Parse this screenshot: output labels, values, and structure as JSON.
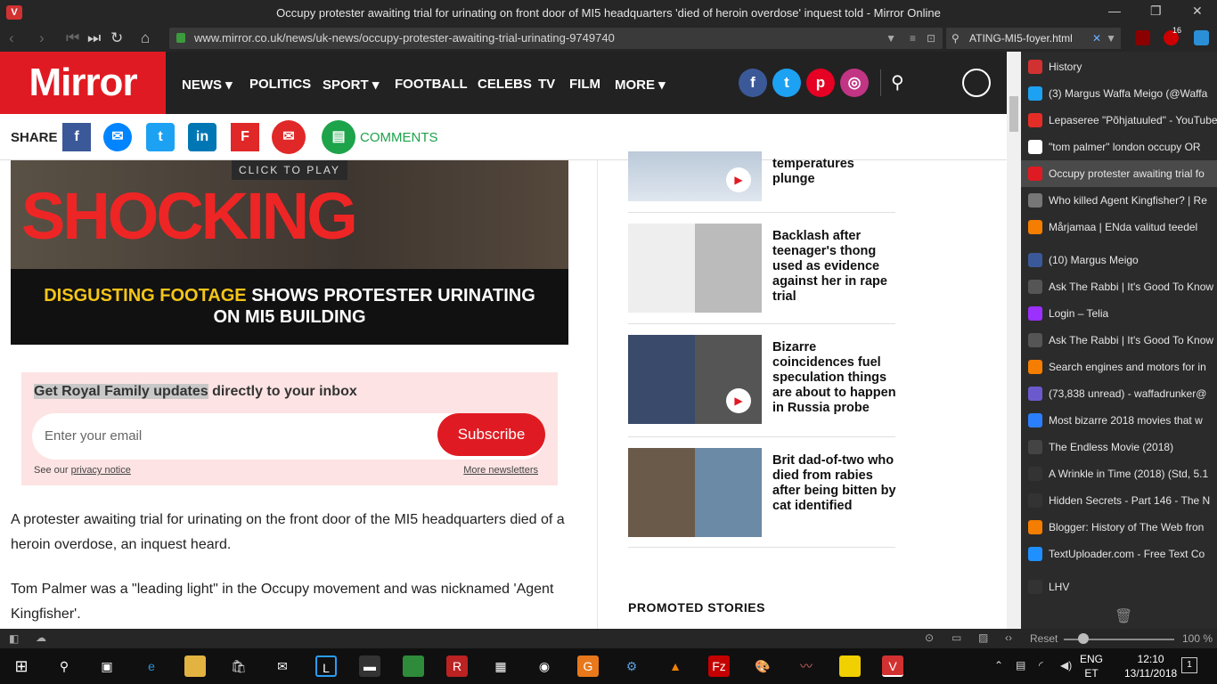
{
  "browser": {
    "title": "Occupy protester awaiting trial for urinating on front door of MI5 headquarters 'died of heroin overdose' inquest told - Mirror Online",
    "url": "www.mirror.co.uk/news/uk-news/occupy-protester-awaiting-trial-urinating-9749740",
    "search_value": "ATING-MI5-foyer.html",
    "ext_badge": "16"
  },
  "mirror": {
    "logo": "Mirror",
    "nav": [
      "NEWS",
      "POLITICS",
      "SPORT",
      "FOOTBALL",
      "CELEBS",
      "TV",
      "FILM",
      "MORE"
    ],
    "share_label": "SHARE",
    "comments_label": "COMMENTS"
  },
  "video": {
    "click_to_play": "CLICK TO PLAY",
    "overlay": "SHOCKING",
    "caption_highlight": "DISGUSTING FOOTAGE",
    "caption_rest": "SHOWS PROTESTER URINATING ON MI5 BUILDING"
  },
  "newsletter": {
    "heading_highlight": "Get Royal Family updates",
    "heading_rest": "directly to your inbox",
    "email_placeholder": "Enter your email",
    "subscribe": "Subscribe",
    "privacy_prefix": "See our",
    "privacy_link": "privacy notice",
    "more_newsletters": "More newsletters"
  },
  "article": {
    "p1": "A protester awaiting trial for urinating on the front door of the MI5 headquarters died of a heroin overdose, an inquest heard.",
    "p2": "Tom Palmer was a \"leading light\" in the Occupy movement and was nicknamed 'Agent Kingfisher'."
  },
  "sidebar_stories": [
    {
      "title": "temperatures plunge"
    },
    {
      "title": "Backlash after teenager's thong used as evidence against her in rape trial"
    },
    {
      "title": "Bizarre coincidences fuel speculation things are about to happen in Russia probe"
    },
    {
      "title": "Brit dad-of-two who died from rabies after being bitten by cat identified"
    }
  ],
  "promoted": "PROMOTED STORIES",
  "panel_items": [
    {
      "label": "History",
      "icon": "vivaldi-icon",
      "color": "#d23131"
    },
    {
      "label": "(3) Margus Waffa Meigo (@Waffa",
      "icon": "twitter-icon",
      "color": "#1da1f2"
    },
    {
      "label": "Lepaseree \"Põhjatuuled\" - YouTube",
      "icon": "youtube-icon",
      "color": "#e52d27"
    },
    {
      "label": "\"tom palmer\" london occupy OR",
      "icon": "google-icon",
      "color": "#ffffff"
    },
    {
      "label": "Occupy protester awaiting trial fo",
      "icon": "mirror-icon",
      "color": "#e01a22"
    },
    {
      "label": "Who killed Agent Kingfisher? | Re",
      "icon": "globe-icon",
      "color": "#777777"
    },
    {
      "label": "Mårjamaa | ENda valitud teedel",
      "icon": "blogger-icon",
      "color": "#f57d00"
    },
    {
      "label": "(10) Margus Meigo",
      "icon": "facebook-icon",
      "color": "#3b5998"
    },
    {
      "label": "Ask The Rabbi | It's Good To Know",
      "icon": "pin-icon",
      "color": "#555555"
    },
    {
      "label": "Login – Telia",
      "icon": "telia-icon",
      "color": "#9b30ff"
    },
    {
      "label": "Ask The Rabbi | It's Good To Know",
      "icon": "pin-icon",
      "color": "#555555"
    },
    {
      "label": "Search engines and motors for in",
      "icon": "blogger-icon",
      "color": "#f57d00"
    },
    {
      "label": "(73,838 unread) - waffadrunker@",
      "icon": "mail-icon",
      "color": "#6a5acd"
    },
    {
      "label": "Most bizarre 2018 movies that w",
      "icon": "infinity-icon",
      "color": "#2a7fff"
    },
    {
      "label": "The Endless Movie (2018)",
      "icon": "film-icon",
      "color": "#444444"
    },
    {
      "label": "A Wrinkle in Time (2018) (Std, 5.1",
      "icon": "blank-icon",
      "color": "#333333"
    },
    {
      "label": "Hidden Secrets - Part 146 - The N",
      "icon": "blank-icon",
      "color": "#333333"
    },
    {
      "label": "Blogger: History of The Web fron",
      "icon": "blogger-icon",
      "color": "#f57d00"
    },
    {
      "label": "TextUploader.com - Free Text Co",
      "icon": "upload-icon",
      "color": "#1e90ff"
    },
    {
      "label": "LHV",
      "icon": "lhv-icon",
      "color": "#333333"
    }
  ],
  "status": {
    "reset": "Reset",
    "zoom": "100 %"
  },
  "taskbar": {
    "lang1": "ENG",
    "lang2": "ET",
    "time": "12:10",
    "date": "13/11/2018",
    "notif": "1"
  }
}
